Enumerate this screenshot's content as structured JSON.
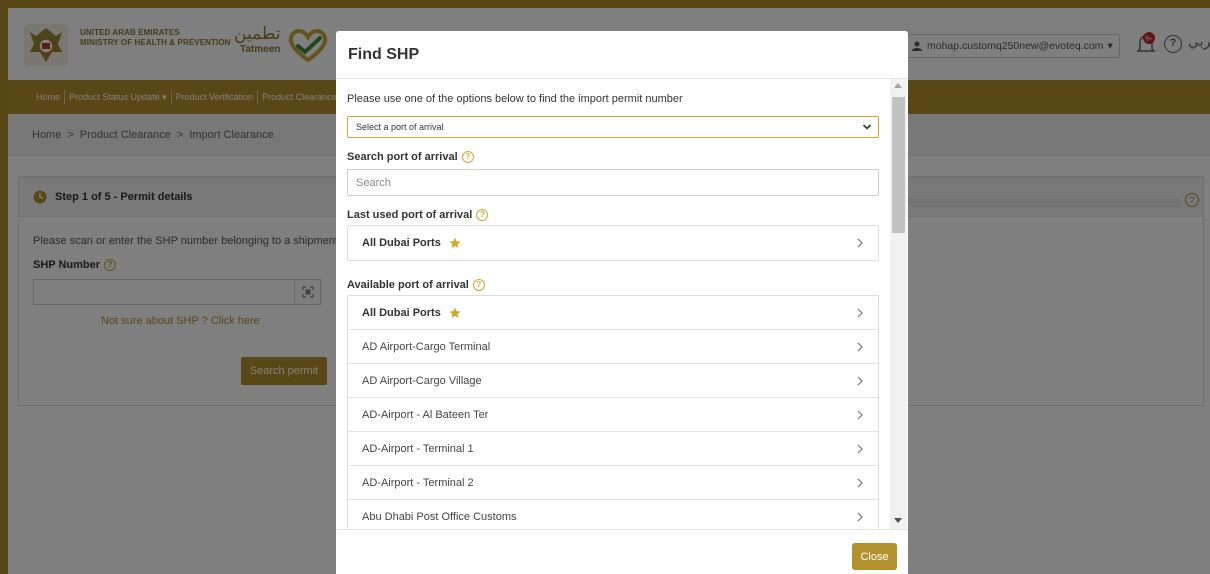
{
  "header": {
    "org_line1": "UNITED ARAB EMIRATES",
    "org_line2": "MINISTRY OF HEALTH & PREVENTION",
    "tatmeen_ar": "تطمين",
    "tatmeen_en": "Tatmeen",
    "user_email": "mohap.customq250new@evoteq.com",
    "notification_badge": "9+",
    "help_symbol": "?",
    "language_label": "عربي"
  },
  "nav": {
    "items": [
      "Home",
      "Product Status Update ▾",
      "Product Verification",
      "Product Clearance ▾"
    ]
  },
  "breadcrumb": {
    "items": [
      "Home",
      ">",
      "Product Clearance",
      ">",
      "Import Clearance"
    ]
  },
  "step": {
    "title": "Step 1 of 5 - Permit details",
    "help_symbol": "?",
    "instruction": "Please scan or enter the SHP number belonging to a shipment.",
    "shp_label": "SHP Number",
    "not_sure_link": "Not sure about SHP ? Click here",
    "search_button": "Search permit"
  },
  "modal": {
    "title": "Find SHP",
    "instruction": "Please use one of the options below to find the import permit number",
    "select_value": "Select a port of arrival",
    "search_label": "Search port of arrival",
    "search_placeholder": "Search",
    "last_used_label": "Last used port of arrival",
    "last_used_ports": [
      {
        "name": "All Dubai Ports",
        "favorite": true
      }
    ],
    "available_label": "Available port of arrival",
    "available_ports": [
      {
        "name": "All Dubai Ports",
        "favorite": true
      },
      {
        "name": "AD Airport-Cargo Terminal",
        "favorite": false
      },
      {
        "name": "AD Airport-Cargo Village",
        "favorite": false
      },
      {
        "name": "AD-Airport - Al Bateen Ter",
        "favorite": false
      },
      {
        "name": "AD-Airport - Terminal 1",
        "favorite": false
      },
      {
        "name": "AD-Airport - Terminal 2",
        "favorite": false
      },
      {
        "name": "Abu Dhabi Post Office Customs",
        "favorite": false
      }
    ],
    "help_symbol": "?",
    "close_button": "Close"
  },
  "colors": {
    "brand_gold": "#b3912c",
    "star": "#d4a62a"
  }
}
